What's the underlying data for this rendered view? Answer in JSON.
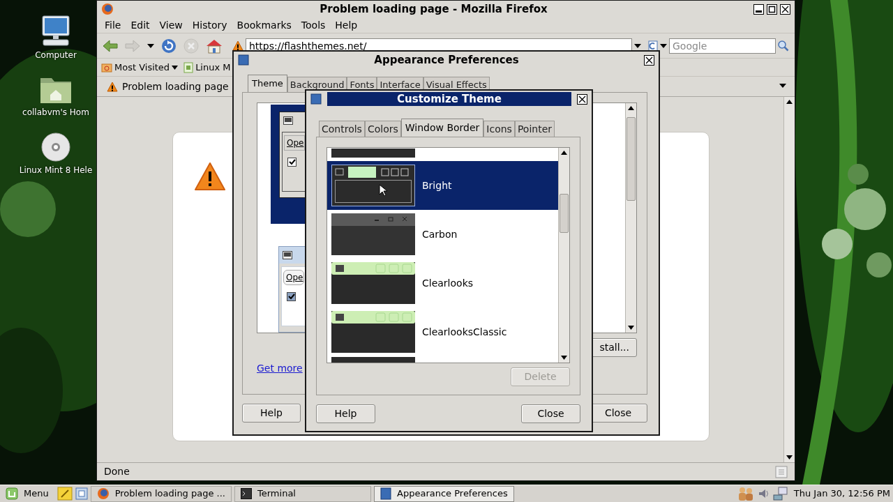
{
  "desktop": {
    "icons": [
      {
        "label": "Computer",
        "kind": "computer"
      },
      {
        "label": "collabvm's Hom",
        "kind": "home"
      },
      {
        "label": "Linux Mint 8 Hele",
        "kind": "disc"
      }
    ]
  },
  "browser": {
    "title": "Problem loading page - Mozilla Firefox",
    "menu": [
      "File",
      "Edit",
      "View",
      "History",
      "Bookmarks",
      "Tools",
      "Help"
    ],
    "url": "https://flashthemes.net/",
    "search": {
      "placeholder": "Google"
    },
    "bookmarks": [
      {
        "label": "Most Visited",
        "kind": "folder"
      },
      {
        "label": "Linux M",
        "kind": "page"
      }
    ],
    "tabs": [
      {
        "label": "Problem loading page",
        "selected": true
      }
    ],
    "status": "Done"
  },
  "appearance": {
    "title": "Appearance Preferences",
    "tabs": [
      {
        "label": "Theme",
        "selected": true
      },
      {
        "label": "Background",
        "selected": false
      },
      {
        "label": "Fonts",
        "selected": false
      },
      {
        "label": "Interface",
        "selected": false
      },
      {
        "label": "Visual Effects",
        "selected": false
      }
    ],
    "previews": [
      {
        "kind": "navy",
        "button": "Ope",
        "checked": true
      },
      {
        "kind": "light",
        "button": "Ope",
        "checked": true
      }
    ],
    "install_button": "stall...",
    "link": "Get more",
    "buttons": [
      "Help",
      "Close"
    ]
  },
  "customize": {
    "title": "Customize Theme",
    "tabs": [
      {
        "label": "Controls",
        "selected": false
      },
      {
        "label": "Colors",
        "selected": false
      },
      {
        "label": "Window Border",
        "selected": true
      },
      {
        "label": "Icons",
        "selected": false
      },
      {
        "label": "Pointer",
        "selected": false
      }
    ],
    "themes": [
      {
        "name": "Bright",
        "kind": "bright",
        "selected": true
      },
      {
        "name": "Carbon",
        "kind": "carbon",
        "selected": false
      },
      {
        "name": "Clearlooks",
        "kind": "clearlooks",
        "selected": false
      },
      {
        "name": "ClearlooksClassic",
        "kind": "clearlooks",
        "selected": false
      }
    ],
    "delete": {
      "label": "Delete",
      "disabled": true
    },
    "buttons": [
      "Help",
      "Close"
    ]
  },
  "taskbar": {
    "menu": "Menu",
    "tasks": [
      {
        "label": "Problem loading page ...",
        "kind": "firefox",
        "selected": false
      },
      {
        "label": "Terminal",
        "kind": "terminal",
        "selected": false
      },
      {
        "label": "Appearance Preferences",
        "kind": "prefs",
        "selected": true
      }
    ],
    "clock": "Thu Jan 30, 12:56 PM"
  }
}
